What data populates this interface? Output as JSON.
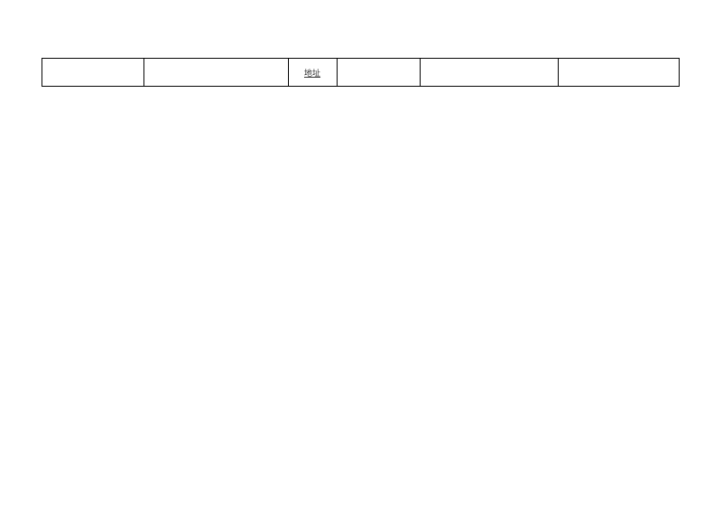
{
  "table": {
    "row": {
      "cell1": "",
      "cell2": "",
      "cell3": "地址",
      "cell4": "",
      "cell5": "",
      "cell6": ""
    }
  }
}
